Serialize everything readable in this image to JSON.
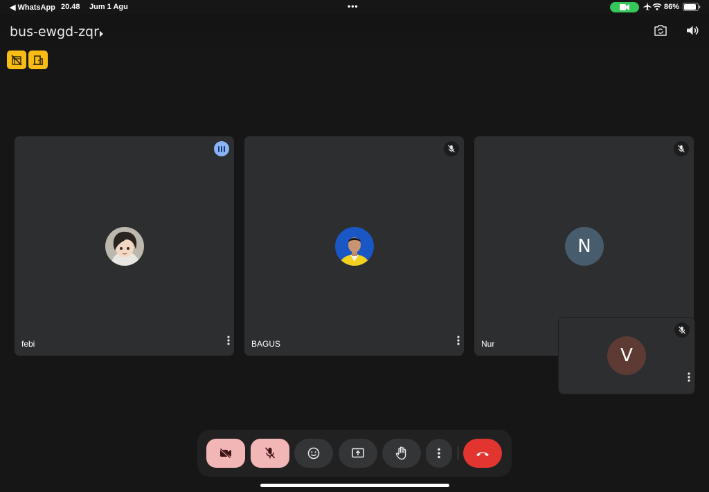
{
  "status_bar": {
    "back_label": "◀ WhatsApp",
    "time": "20.48",
    "date": "Jum 1 Agu",
    "battery_percent": "86%",
    "call_pill_color": "#34c759"
  },
  "meeting": {
    "code": "bus-ewgd-zqr",
    "badges": [
      "no-recording-icon",
      "door-icon"
    ],
    "badge_color": "#f9bc15"
  },
  "participants": [
    {
      "name": "febi",
      "avatar": "photo",
      "status": "speaking"
    },
    {
      "name": "BAGUS",
      "avatar": "photo",
      "status": "muted"
    },
    {
      "name": "Nur",
      "avatar_letter": "N",
      "status": "muted"
    }
  ],
  "self_view": {
    "avatar_letter": "V",
    "status": "muted"
  },
  "controls": [
    {
      "name": "camera-off-button",
      "icon": "video-off-icon",
      "state": "off"
    },
    {
      "name": "mic-off-button",
      "icon": "mic-off-icon",
      "state": "off"
    },
    {
      "name": "reactions-button",
      "icon": "emoji-icon"
    },
    {
      "name": "present-button",
      "icon": "present-screen-icon"
    },
    {
      "name": "raise-hand-button",
      "icon": "hand-icon"
    },
    {
      "name": "more-options-button",
      "icon": "more-vert-icon"
    },
    {
      "name": "end-call-button",
      "icon": "call-end-icon",
      "color": "#e2352f"
    }
  ]
}
